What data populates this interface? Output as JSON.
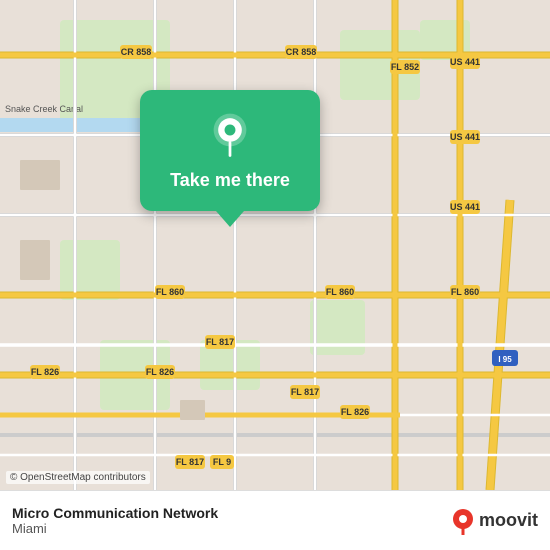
{
  "map": {
    "attribution": "© OpenStreetMap contributors",
    "background_color": "#e8e0d8"
  },
  "cta": {
    "button_label": "Take me there",
    "pin_color": "#2db87a",
    "button_bg": "#2db87a"
  },
  "info_bar": {
    "app_name": "Micro Communication Network",
    "city": "Miami",
    "separator": ",",
    "logo_text": "moovit"
  },
  "road_labels": [
    "CR 858",
    "CR 858",
    "US 441",
    "FL 852",
    "US 441",
    "US 441",
    "FL 860",
    "FL 860",
    "FL 860",
    "FL 826",
    "FL 826",
    "FL 817",
    "FL 817",
    "FL 817",
    "FL 826",
    "FL 9",
    "I 95",
    "Snake Creek Canal"
  ]
}
